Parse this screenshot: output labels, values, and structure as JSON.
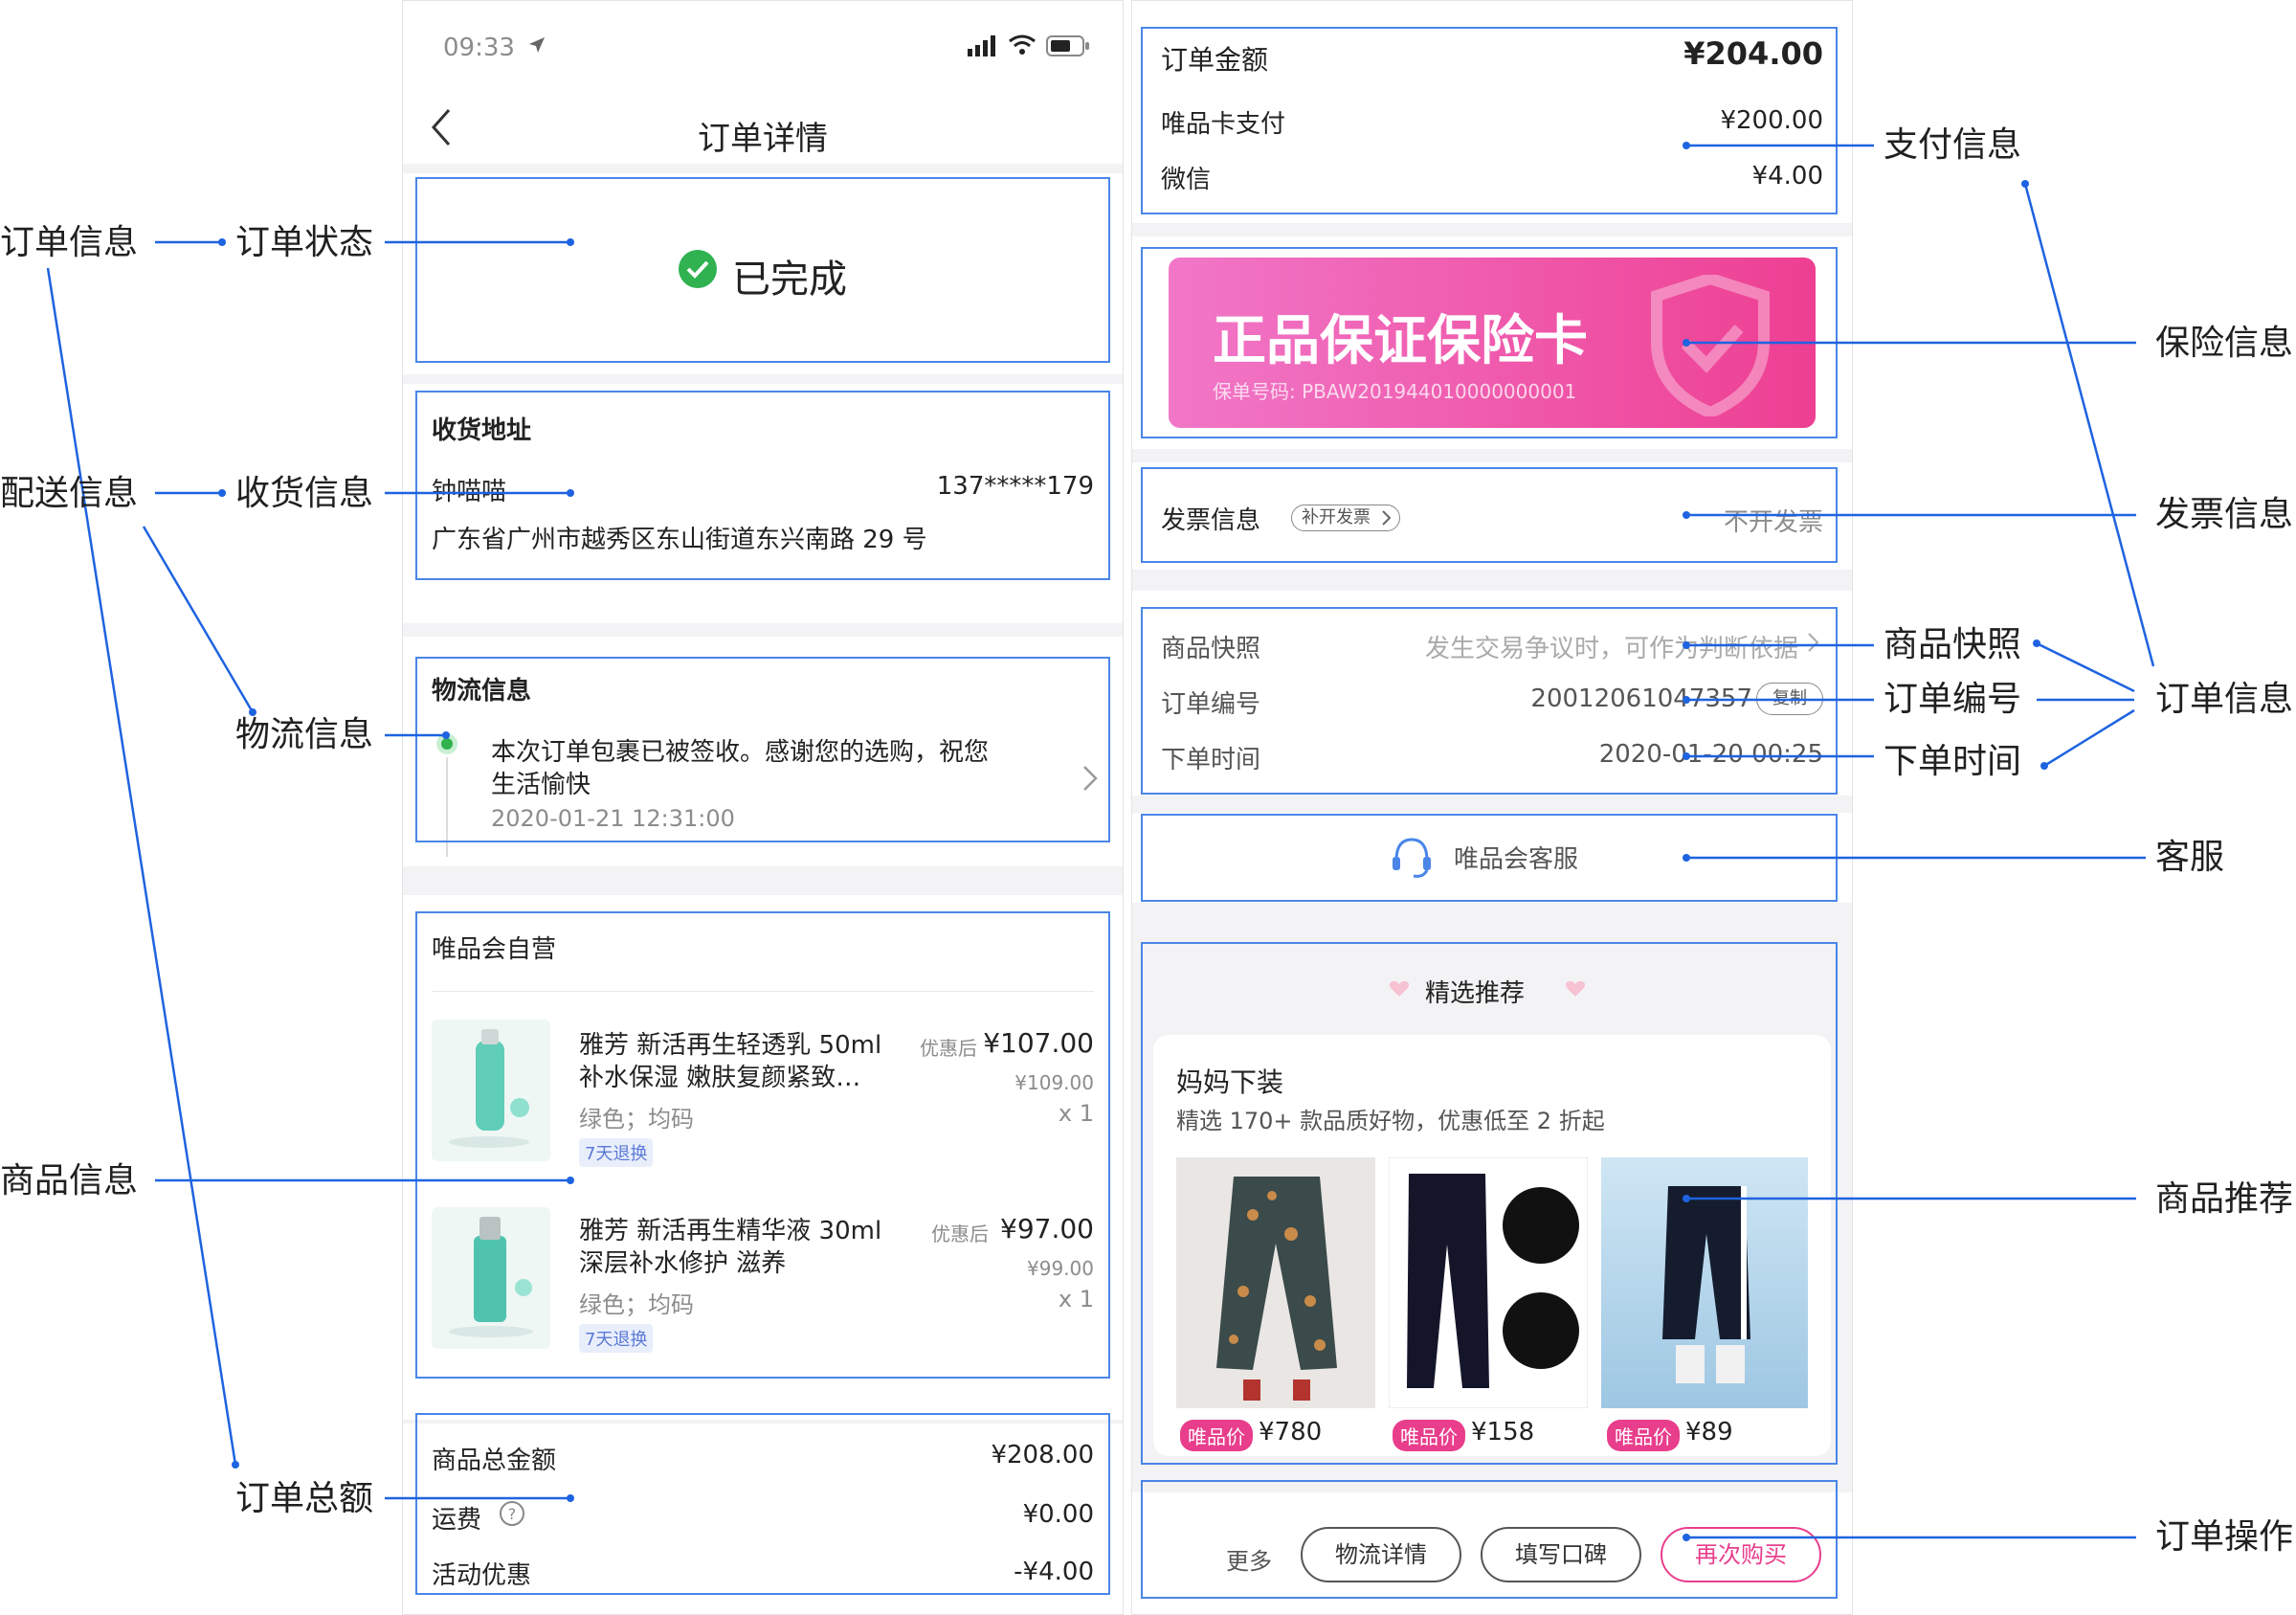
{
  "left_labels": {
    "order_info": "订单信息",
    "delivery_info": "配送信息",
    "goods_info": "商品信息",
    "order_status": "订单状态",
    "receiving_info": "收货信息",
    "logistics_info": "物流信息",
    "order_total": "订单总额"
  },
  "right_labels": {
    "payment_info": "支付信息",
    "insurance_info": "保险信息",
    "invoice_info": "发票信息",
    "snapshot": "商品快照",
    "order_number": "订单编号",
    "order_time": "下单时间",
    "order_info": "订单信息",
    "customer_service": "客服",
    "recommend": "商品推荐",
    "order_actions": "订单操作"
  },
  "phone_left": {
    "status_bar": {
      "time": "09:33"
    },
    "nav": {
      "title": "订单详情"
    },
    "status": {
      "text": "已完成"
    },
    "address": {
      "heading": "收货地址",
      "name": "钟喵喵",
      "phone": "137*****179",
      "address": "广东省广州市越秀区东山街道东兴南路 29 号"
    },
    "logistics": {
      "heading": "物流信息",
      "message_line1": "本次订单包裹已被签收。感谢您的选购，祝您",
      "message_line2": "生活愉快",
      "time": "2020-01-21 12:31:00"
    },
    "shop": {
      "name": "唯品会自营",
      "items": [
        {
          "title_line1": "雅芳 新活再生轻透乳 50ml",
          "title_line2": "补水保湿 嫩肤复颜紧致…",
          "discount_label": "优惠后",
          "price": "¥107.00",
          "original_price": "¥109.00",
          "spec": "绿色；均码",
          "qty": "x 1",
          "tag": "7天退换"
        },
        {
          "title_line1": "雅芳 新活再生精华液 30ml",
          "title_line2": "深层补水修护 滋养",
          "discount_label": "优惠后",
          "price": "¥97.00",
          "original_price": "¥99.00",
          "spec": "绿色；均码",
          "qty": "x 1",
          "tag": "7天退换"
        }
      ]
    },
    "totals": {
      "goods_total_label": "商品总金额",
      "goods_total": "¥208.00",
      "shipping_label": "运费",
      "shipping": "¥0.00",
      "promo_label": "活动优惠",
      "promo": "-¥4.00"
    }
  },
  "phone_right": {
    "payment": {
      "amount_label": "订单金额",
      "amount": "¥204.00",
      "card_label": "唯品卡支付",
      "card_amount": "¥200.00",
      "wechat_label": "微信",
      "wechat_amount": "¥4.00"
    },
    "insurance": {
      "title": "正品保证保险卡",
      "policy": "保单号码: PBAW201944010000000001"
    },
    "invoice": {
      "label": "发票信息",
      "reissue": "补开发票",
      "value": "不开发票"
    },
    "order_meta": {
      "snapshot_label": "商品快照",
      "snapshot_hint": "发生交易争议时，可作为判断依据",
      "number_label": "订单编号",
      "number": "20012061047357",
      "copy": "复制",
      "time_label": "下单时间",
      "time": "2020-01-20 00:25"
    },
    "service": {
      "label": "唯品会客服"
    },
    "recommend": {
      "heading": "精选推荐",
      "title": "妈妈下装",
      "subtitle": "精选 170+ 款品质好物，优惠低至 2 折起",
      "price_tag": "唯品价",
      "prices": [
        "¥780",
        "¥158",
        "¥89"
      ]
    },
    "actions": {
      "more": "更多",
      "logistics": "物流详情",
      "review": "填写口碑",
      "rebuy": "再次购买"
    }
  },
  "colors": {
    "annotation_line": "#1e63e0",
    "box_outline": "#4a86e8",
    "accent_pink": "#e83e8c",
    "success_green": "#2fb24f"
  }
}
